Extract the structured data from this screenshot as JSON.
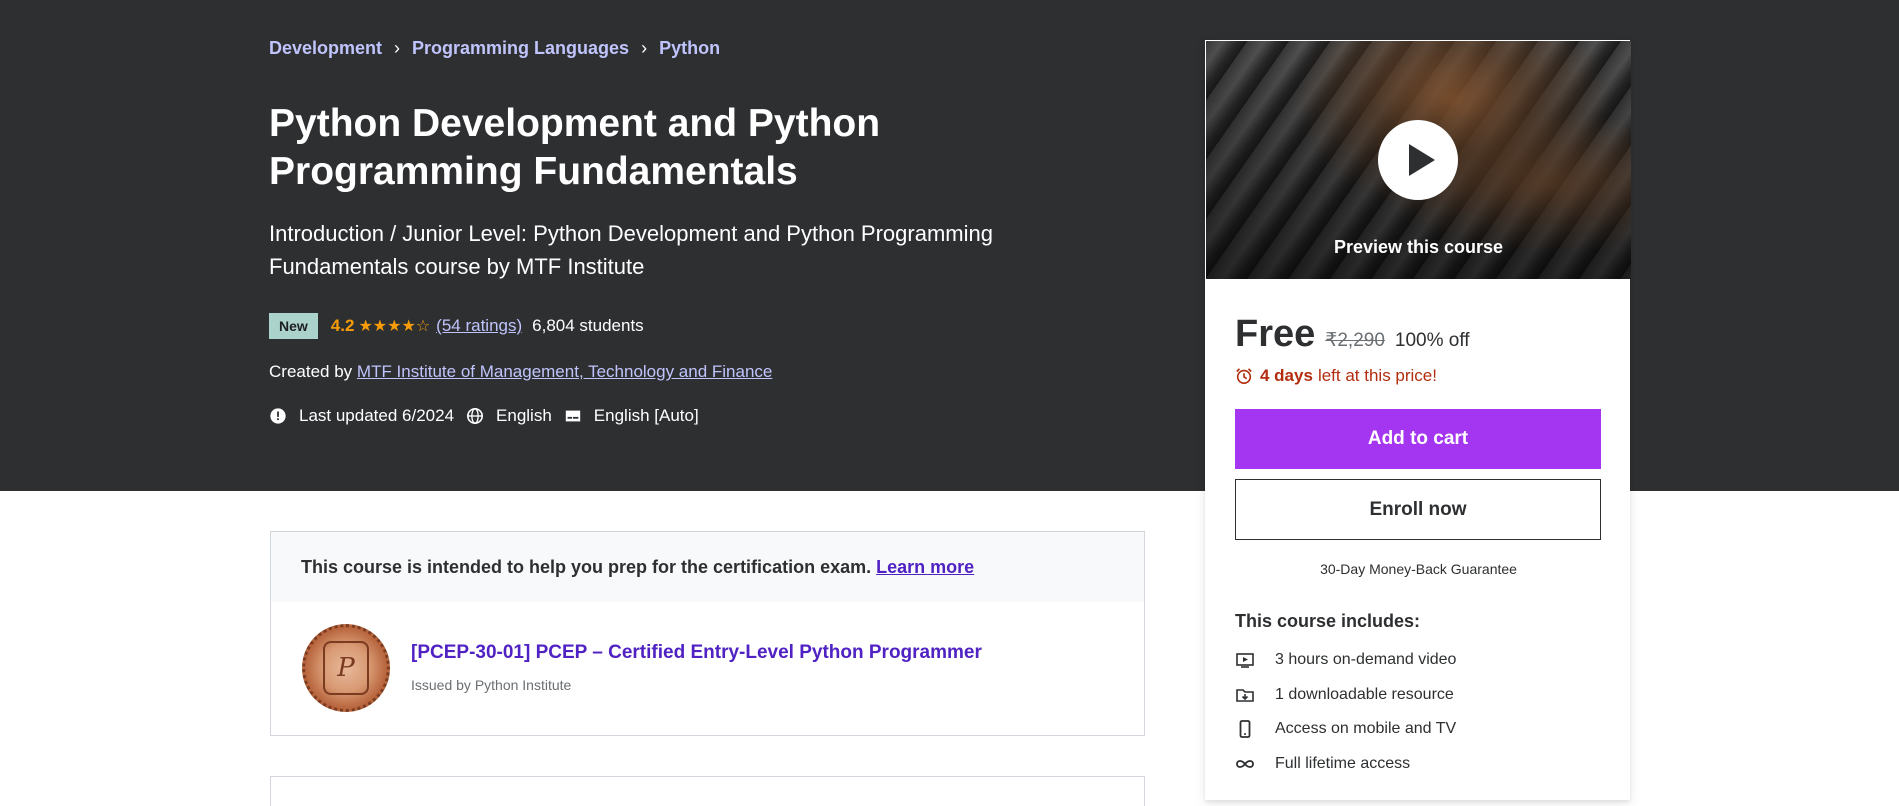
{
  "breadcrumb": [
    "Development",
    "Programming Languages",
    "Python"
  ],
  "course": {
    "title": "Python Development and Python Programming Fundamentals",
    "subtitle": "Introduction / Junior Level: Python Development and Python Programming Fundamentals course by MTF Institute",
    "badge": "New",
    "rating": "4.2",
    "stars_value": 4.2,
    "stars_max": 5,
    "ratings_link": "(54 ratings)",
    "students": "6,804 students",
    "created_by_label": "Created by",
    "author": "MTF Institute of Management, Technology and Finance",
    "last_updated": "Last updated 6/2024",
    "language": "English",
    "captions": "English [Auto]"
  },
  "sidebar": {
    "preview_label": "Preview this course",
    "price": "Free",
    "original_price": "₹2,290",
    "discount": "100% off",
    "timer_bold": "4 days",
    "timer_rest": "left at this price!",
    "add_to_cart": "Add to cart",
    "enroll_now": "Enroll now",
    "guarantee": "30-Day Money-Back Guarantee",
    "includes_title": "This course includes:",
    "includes": [
      {
        "icon": "video-icon",
        "text": "3 hours on-demand video"
      },
      {
        "icon": "download-icon",
        "text": "1 downloadable resource"
      },
      {
        "icon": "mobile-icon",
        "text": "Access on mobile and TV"
      },
      {
        "icon": "infinity-icon",
        "text": "Full lifetime access"
      }
    ]
  },
  "certification": {
    "intro": "This course is intended to help you prep for the certification exam.",
    "learn_more": "Learn more",
    "name": "[PCEP-30-01] PCEP – Certified Entry-Level Python Programmer",
    "issuer": "Issued by Python Institute"
  },
  "colors": {
    "hero_bg": "#2d2f31",
    "accent_purple": "#a435f0",
    "link_lavender": "#c0c4fc",
    "star_orange": "#f69c08",
    "timer_red": "#b32d0f",
    "badge_teal": "#acd2cc",
    "cert_link": "#5022c3"
  }
}
